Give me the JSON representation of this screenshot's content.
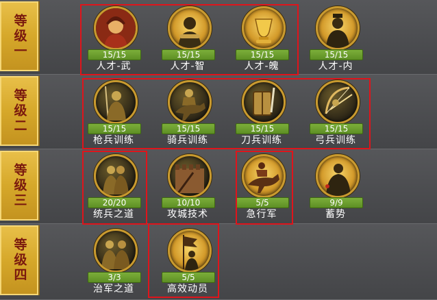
{
  "tiers": [
    {
      "label": "等级一"
    },
    {
      "label": "等级二"
    },
    {
      "label": "等级三"
    },
    {
      "label": "等级四"
    }
  ],
  "skills": [
    {
      "name": "人才-武",
      "count": "15/15",
      "icon": "warrior-helmet-icon",
      "highlighted": true
    },
    {
      "name": "人才-智",
      "count": "15/15",
      "icon": "scholar-scroll-icon",
      "highlighted": true
    },
    {
      "name": "人才-魄",
      "count": "15/15",
      "icon": "golden-vessel-icon",
      "highlighted": true
    },
    {
      "name": "人才-内",
      "count": "15/15",
      "icon": "minister-icon",
      "highlighted": false
    },
    {
      "name": "枪兵训练",
      "count": "15/15",
      "icon": "spearman-icon",
      "highlighted": true
    },
    {
      "name": "骑兵训练",
      "count": "15/15",
      "icon": "cavalry-icon",
      "highlighted": true
    },
    {
      "name": "刀兵训练",
      "count": "15/15",
      "icon": "shield-swordsman-icon",
      "highlighted": true
    },
    {
      "name": "弓兵训练",
      "count": "15/15",
      "icon": "archer-bow-icon",
      "highlighted": true
    },
    {
      "name": "统兵之道",
      "count": "20/20",
      "icon": "troop-formation-icon",
      "highlighted": true
    },
    {
      "name": "攻城技术",
      "count": "10/10",
      "icon": "city-wall-icon",
      "highlighted": false
    },
    {
      "name": "急行军",
      "count": "5/5",
      "icon": "charging-rider-icon",
      "highlighted": true
    },
    {
      "name": "蓄势",
      "count": "9/9",
      "icon": "armored-general-icon",
      "highlighted": false
    },
    {
      "name": "治军之道",
      "count": "3/3",
      "icon": "army-discipline-icon",
      "highlighted": false
    },
    {
      "name": "高效动员",
      "count": "5/5",
      "icon": "banner-mobilize-icon",
      "highlighted": true
    }
  ],
  "colors": {
    "highlight": "#e0141b",
    "count_bar": "#6a9b2c",
    "tier_gold": "#d6a82a",
    "tier_text": "#7a1a0e"
  }
}
